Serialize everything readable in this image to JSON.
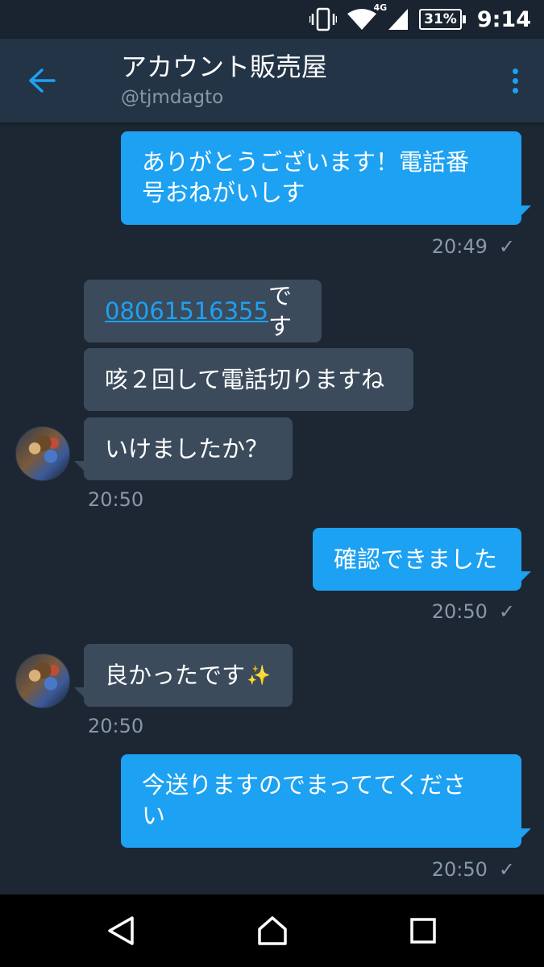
{
  "status_bar": {
    "network_label": "4G",
    "battery_percent": "31%",
    "time": "9:14",
    "icons": [
      "vibrate-icon",
      "wifi-icon",
      "cell-signal-icon",
      "battery-icon"
    ]
  },
  "header": {
    "title": "アカウント販売屋",
    "handle": "@tjmdagto",
    "back_icon": "arrow-left-icon",
    "menu_icon": "more-vertical-icon"
  },
  "messages": [
    {
      "direction": "out",
      "text": "ありがとうございます！電話番号おねがいしす",
      "line1": "ありがとうございます！電話番",
      "line2": "号おねがいしす"
    },
    {
      "direction": "out_ts",
      "time": "20:49",
      "read": "✓"
    },
    {
      "direction": "in",
      "phone": "08061516355",
      "suffix": "です"
    },
    {
      "direction": "in",
      "text": "咳２回して電話切りますね"
    },
    {
      "direction": "in",
      "text": "いけましたか？"
    },
    {
      "direction": "in_ts",
      "time": "20:50"
    },
    {
      "direction": "out",
      "text": "確認できました"
    },
    {
      "direction": "out_ts",
      "time": "20:50",
      "read": "✓"
    },
    {
      "direction": "in",
      "text": "良かったです",
      "emoji": "✨"
    },
    {
      "direction": "in_ts",
      "time": "20:50"
    },
    {
      "direction": "out",
      "text": "今送りますのでまっててください",
      "line1": "今送りますのでまっててくださ",
      "line2": "い"
    },
    {
      "direction": "out_ts",
      "time": "20:50",
      "read": "✓"
    }
  ],
  "colors": {
    "background": "#1c2733",
    "header": "#243447",
    "outgoing_bubble": "#1da1f2",
    "incoming_bubble": "#3b4b5c",
    "secondary_text": "#8899a6",
    "accent": "#1da1f2"
  },
  "nav_bar": {
    "buttons": [
      "back-triangle-icon",
      "home-icon",
      "recents-icon"
    ]
  }
}
